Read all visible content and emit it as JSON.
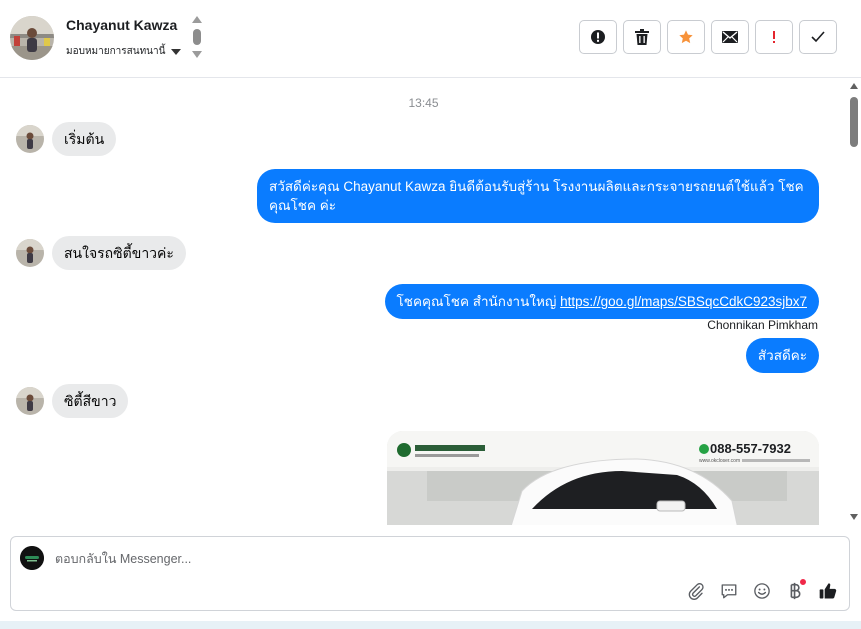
{
  "header": {
    "contact_name": "Chayanut Kawza",
    "assign_label": "มอบหมายการสนทนานี้"
  },
  "toolbar": {
    "buttons": [
      {
        "icon": "alert-circle-icon",
        "name": "mark-spam-button"
      },
      {
        "icon": "trash-icon",
        "name": "delete-button"
      },
      {
        "icon": "star-icon",
        "name": "follow-up-button",
        "color": "#f7923a"
      },
      {
        "icon": "envelope-icon",
        "name": "mark-unread-button"
      },
      {
        "icon": "exclamation-icon",
        "name": "priority-button",
        "color": "#e4252d"
      },
      {
        "icon": "check-icon",
        "name": "mark-done-button"
      }
    ]
  },
  "chat": {
    "timestamp": "13:45",
    "messages": [
      {
        "direction": "in",
        "text": "เริ่มต้น"
      },
      {
        "direction": "out",
        "line1": "สวัสดีค่ะคุณ Chayanut Kawza ยินดีต้อนรับสู่ร้าน โรงงานผลิตและกระจายรถยนต์ใช้แล้ว โชค",
        "line2": "คุณโชค ค่ะ"
      },
      {
        "direction": "in",
        "text": "สนใจรถซิตี้ขาวค่ะ"
      },
      {
        "direction": "out",
        "text_prefix": "โชคคุณโชค สำนักงานใหญ่ ",
        "link": "https://goo.gl/maps/SBSqcCdkC923sjbx7"
      },
      {
        "sender": "Chonnikan Pimkham"
      },
      {
        "direction": "out",
        "text": "สัวสดีคะ"
      },
      {
        "direction": "in",
        "text": "ซิตี้สีขาว"
      },
      {
        "direction": "out",
        "type": "image",
        "phone": "088-557-7932",
        "site": "www.okcloser.com"
      }
    ]
  },
  "composer": {
    "placeholder": "ตอบกลับใน Messenger..."
  },
  "colors": {
    "outgoing_bubble": "#0a7cff",
    "incoming_bubble": "#e9eaeb",
    "notification_dot": "#f02849"
  }
}
